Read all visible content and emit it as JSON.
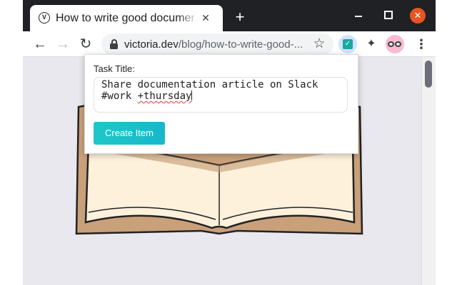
{
  "tab": {
    "favicon_letter": "V",
    "title": "How to write good documentation",
    "close_glyph": "✕"
  },
  "window_controls": {
    "new_tab_glyph": "+",
    "close_glyph": "✕"
  },
  "toolbar": {
    "back_glyph": "←",
    "forward_glyph": "→",
    "reload_glyph": "↻",
    "url_domain": "victoria.dev",
    "url_path": "/blog/how-to-write-good-...",
    "star_glyph": "☆",
    "menu_glyph": "⋮",
    "extension_todo_icon": "todo-check-icon",
    "extension_puzzle_icon": "puzzle-icon",
    "profile_icon": "glasses-avatar-icon"
  },
  "popup": {
    "label": "Task Title:",
    "task_line1": "Share documentation article on Slack",
    "task_line2_prefix": "#work ",
    "task_line2_tag": "+thursday",
    "button_label": "Create Item"
  },
  "colors": {
    "accent": "#1fc7c7",
    "close_button": "#e95420",
    "book_cover": "#c9a07a",
    "book_pages": "#fdf1dc",
    "letters": "#4f6fe8"
  }
}
